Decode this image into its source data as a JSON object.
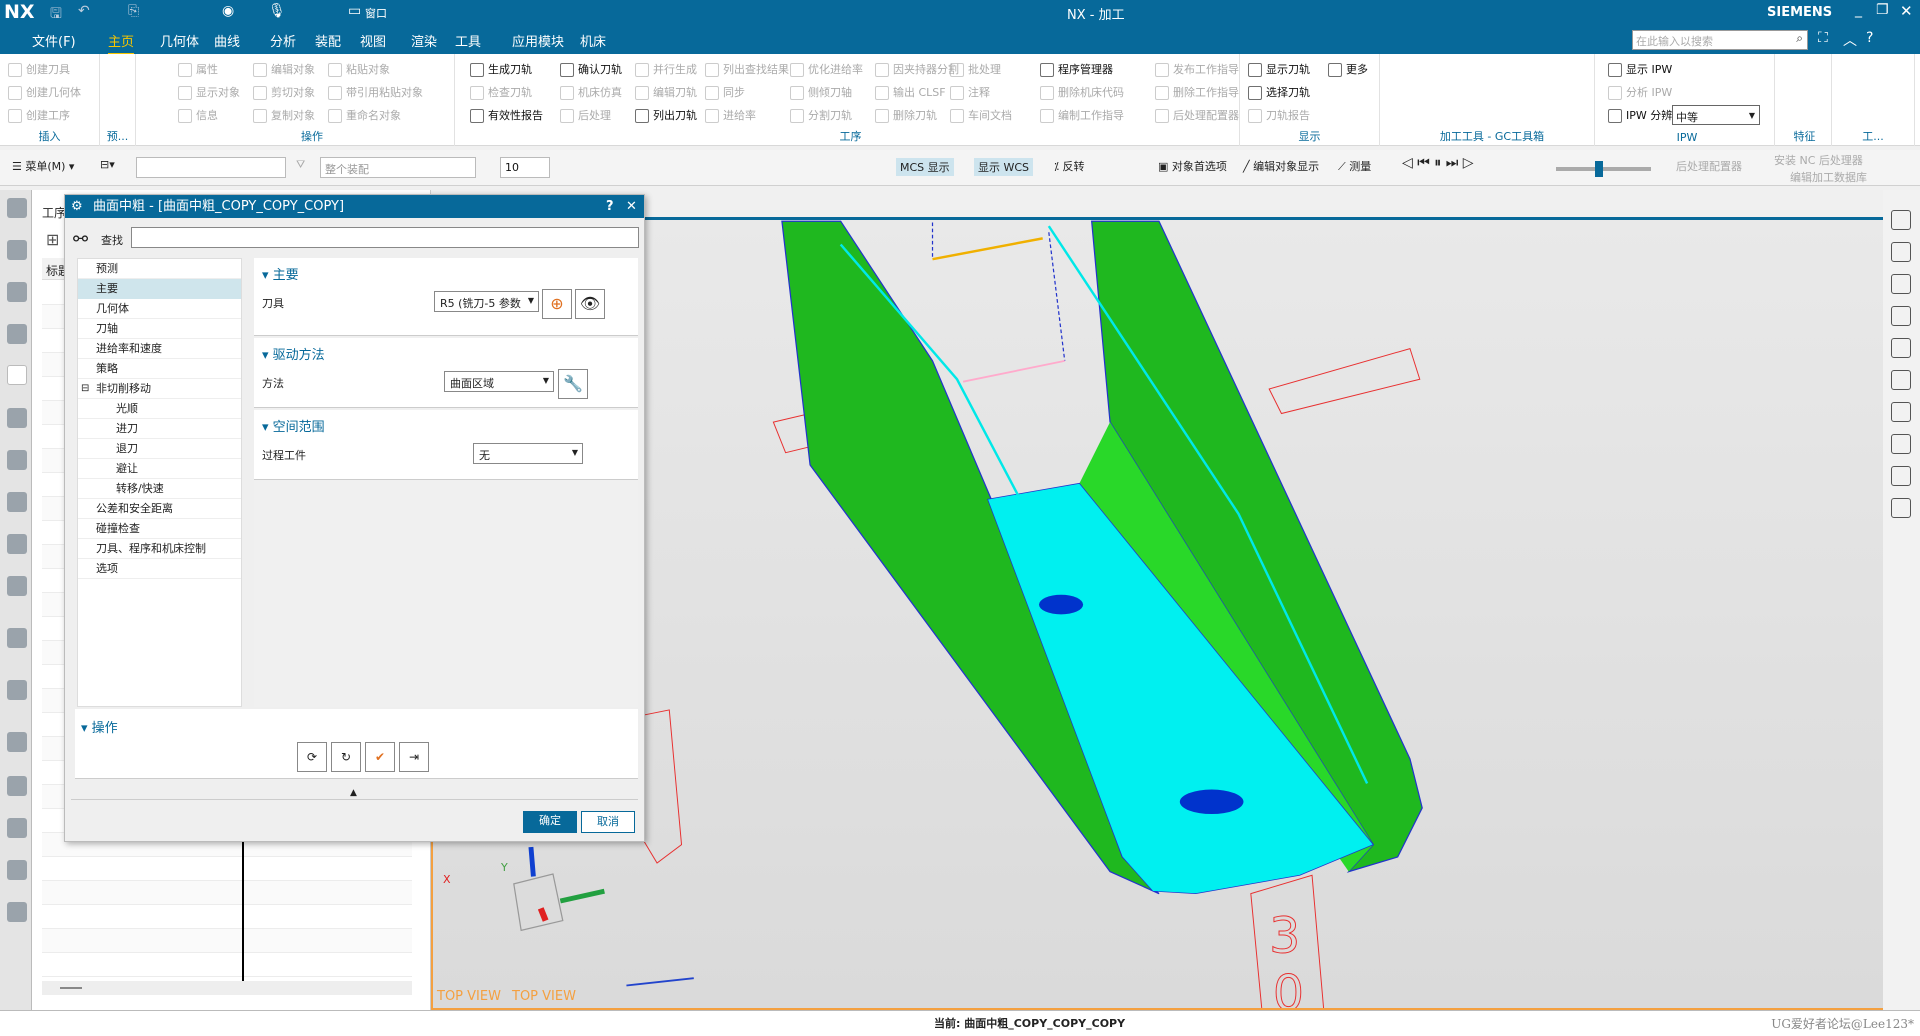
{
  "app": {
    "logo": "NX",
    "title": "NX - 加工",
    "brand": "SIEMENS",
    "search_placeholder": "在此输入以搜索",
    "quick_access_window": "窗口"
  },
  "menu": [
    "文件(F)",
    "主页",
    "几何体",
    "曲线",
    "分析",
    "装配",
    "视图",
    "渲染",
    "工具",
    "应用模块",
    "机床"
  ],
  "menu_active": "主页",
  "ribbon": [
    {
      "label": "插入",
      "cols": [
        [
          {
            "t": "创建刀具"
          },
          {
            "t": "创建几何体"
          },
          {
            "t": "创建工序"
          }
        ]
      ]
    },
    {
      "label": "预...",
      "cols": []
    },
    {
      "label": "操作",
      "cols": [
        [
          {
            "t": "属性"
          },
          {
            "t": "显示对象"
          },
          {
            "t": "信息"
          }
        ],
        [
          {
            "t": "编辑对象"
          },
          {
            "t": "剪切对象"
          },
          {
            "t": "复制对象"
          }
        ],
        [
          {
            "t": "粘贴对象"
          },
          {
            "t": "带引用粘贴对象"
          },
          {
            "t": "重命名对象"
          }
        ]
      ]
    },
    {
      "label": "工序",
      "cols": [
        [
          {
            "t": "生成刀轨",
            "on": true
          },
          {
            "t": "检查刀轨"
          },
          {
            "t": "有效性报告",
            "on": true
          }
        ],
        [
          {
            "t": "确认刀轨",
            "on": true
          },
          {
            "t": "机床仿真"
          },
          {
            "t": "后处理"
          }
        ],
        [
          {
            "t": "并行生成"
          },
          {
            "t": "编辑刀轨"
          },
          {
            "t": "列出刀轨",
            "on": true
          }
        ],
        [
          {
            "t": "列出查找结果"
          },
          {
            "t": "同步"
          },
          {
            "t": "进给率"
          }
        ],
        [
          {
            "t": "优化进给率"
          },
          {
            "t": "侧倾刀轴"
          },
          {
            "t": "分割刀轨"
          }
        ],
        [
          {
            "t": "因夹持器分割"
          },
          {
            "t": "输出 CLSF"
          },
          {
            "t": "删除刀轨"
          }
        ],
        [
          {
            "t": "批处理"
          },
          {
            "t": "注释"
          },
          {
            "t": "车间文档"
          }
        ],
        [
          {
            "t": "程序管理器",
            "on": true
          },
          {
            "t": "删除机床代码"
          },
          {
            "t": "编制工作指导"
          }
        ],
        [
          {
            "t": "发布工作指导"
          },
          {
            "t": "删除工作指导"
          },
          {
            "t": "后处理配置器"
          }
        ]
      ]
    },
    {
      "label": "显示",
      "cols": [
        [
          {
            "t": "显示刀轨",
            "on": true
          },
          {
            "t": "选择刀轨",
            "on": true
          },
          {
            "t": "刀轨报告"
          }
        ],
        [
          {
            "t": "更多",
            "on": true
          }
        ]
      ]
    },
    {
      "label": "加工工具 - GC工具箱",
      "cols": []
    },
    {
      "label": "IPW",
      "cols": [
        [
          {
            "t": "显示 IPW",
            "on": true
          },
          {
            "t": "分析 IPW"
          },
          {
            "t": "IPW 分辨率",
            "on": true
          }
        ]
      ]
    },
    {
      "label": "特征",
      "cols": []
    },
    {
      "label": "工...",
      "cols": []
    }
  ],
  "ipw_resolution": "中等",
  "toolbar2": {
    "menu": "菜单(M)",
    "assembly_filter": "整个装配",
    "count": "10",
    "mcs": "MCS 显示",
    "wcs": "显示 WCS",
    "reverse": "反转",
    "obj_pref": "对象首选项",
    "edit_display": "编辑对象显示",
    "measure": "测量",
    "post_config": "后处理配置器",
    "install_post": "安装 NC 后处理器",
    "edit_db": "编辑加工数据库",
    "animation_speed": 0.45
  },
  "navigator": {
    "title": "工序导航器",
    "column": "标题"
  },
  "dialog": {
    "title": "曲面中粗 - [曲面中粗_COPY_COPY_COPY]",
    "help": "?",
    "close": "✕",
    "find_label": "查找",
    "find_value": "",
    "tree": [
      {
        "t": "预测",
        "l": 0
      },
      {
        "t": "主要",
        "l": 0,
        "sel": true
      },
      {
        "t": "几何体",
        "l": 0
      },
      {
        "t": "刀轴",
        "l": 0
      },
      {
        "t": "进给率和速度",
        "l": 0
      },
      {
        "t": "策略",
        "l": 0
      },
      {
        "t": "非切削移动",
        "l": 0,
        "exp": true
      },
      {
        "t": "光顺",
        "l": 1
      },
      {
        "t": "进刀",
        "l": 1
      },
      {
        "t": "退刀",
        "l": 1
      },
      {
        "t": "避让",
        "l": 1
      },
      {
        "t": "转移/快速",
        "l": 1
      },
      {
        "t": "公差和安全距离",
        "l": 0
      },
      {
        "t": "碰撞检查",
        "l": 0
      },
      {
        "t": "刀具、程序和机床控制",
        "l": 0
      },
      {
        "t": "选项",
        "l": 0
      }
    ],
    "main": {
      "header": "主要",
      "tool_label": "刀具",
      "tool_value": "R5 (铣刀-5 参数"
    },
    "drive": {
      "header": "驱动方法",
      "method_label": "方法",
      "method_value": "曲面区域"
    },
    "space": {
      "header": "空间范围",
      "ipw_label": "过程工件",
      "ipw_value": "无"
    },
    "ops": {
      "header": "操作"
    },
    "ok": "确定",
    "cancel": "取消"
  },
  "viewport": {
    "view_labels": [
      "TOP VIEW",
      "TOP VIEW"
    ],
    "axis_x": "X",
    "axis_y": "Y",
    "colors": {
      "wall": "#1fb81f",
      "floor": "#00f0f0",
      "sketch": "#e83030"
    }
  },
  "status": {
    "current": "当前: 曲面中粗_COPY_COPY_COPY",
    "watermark": "UG爱好者论坛@Lee123*"
  }
}
